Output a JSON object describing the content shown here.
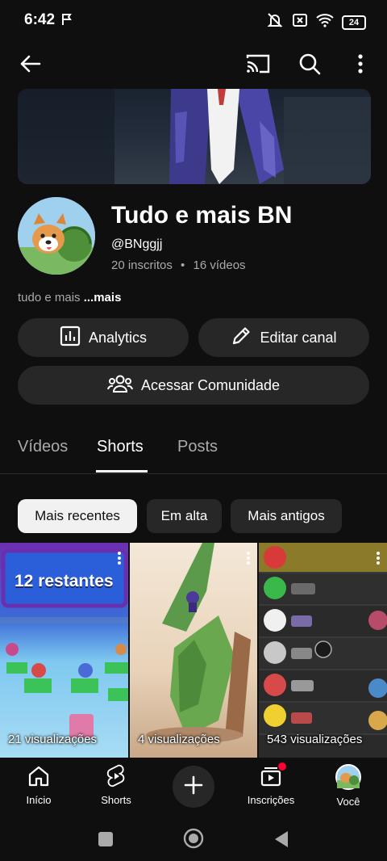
{
  "status_bar": {
    "time": "6:42",
    "battery": "24"
  },
  "channel": {
    "name": "Tudo e mais BN",
    "handle": "@BNggjj",
    "subscribers": "20 inscritos",
    "separator": "•",
    "videos": "16 vídeos",
    "description": "tudo e mais",
    "more": "...mais"
  },
  "buttons": {
    "analytics": "Analytics",
    "edit": "Editar canal",
    "community": "Acessar Comunidade"
  },
  "tabs": [
    "Vídeos",
    "Shorts",
    "Posts"
  ],
  "active_tab": "Shorts",
  "chips": [
    "Mais recentes",
    "Em alta",
    "Mais antigos"
  ],
  "shorts": [
    {
      "views": "21 visualizações",
      "overlay_text": "12 restantes"
    },
    {
      "views": "4 visualizações"
    },
    {
      "views": "543 visualizações"
    }
  ],
  "bottom_nav": [
    "Início",
    "Shorts",
    "Inscrições",
    "Você"
  ],
  "colors": {
    "background": "#0f0f0f",
    "button": "#272727",
    "chip_active": "#f1f1f1",
    "notification_dot": "#ff0033"
  }
}
